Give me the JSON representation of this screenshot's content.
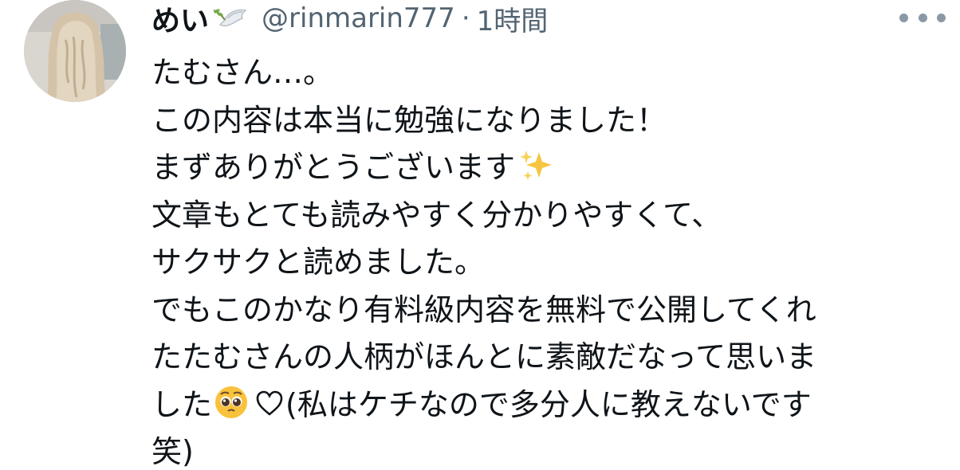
{
  "tweet": {
    "author": {
      "display_name": "めい",
      "emoji_icon": "dove-with-olive-branch-icon",
      "handle": "@rinmarin777",
      "separator": "·",
      "timestamp": "1時間"
    },
    "more_icon": "more-dots-icon",
    "body": {
      "lines": [
        "たむさん…。",
        "この内容は本当に勉強になりました！",
        "まずありがとうございます",
        "文章もとても読みやすく分かりやすくて、",
        "サクサクと読めました。",
        "でもこのかなり有料級内容を無料で公開してくれ",
        "たたむさんの人柄がほんとに素敵だなって思いま",
        "した",
        "(私はケチなので多分人に教えないです",
        "笑)"
      ],
      "emojis": {
        "line3_trailing": "sparkles-icon",
        "line8_after_text": "pleading-face-icon",
        "line8_symbol": "white-heart-outline-icon"
      }
    },
    "colors": {
      "text": "#0f1419",
      "secondary": "#536471",
      "background": "#ffffff"
    }
  }
}
